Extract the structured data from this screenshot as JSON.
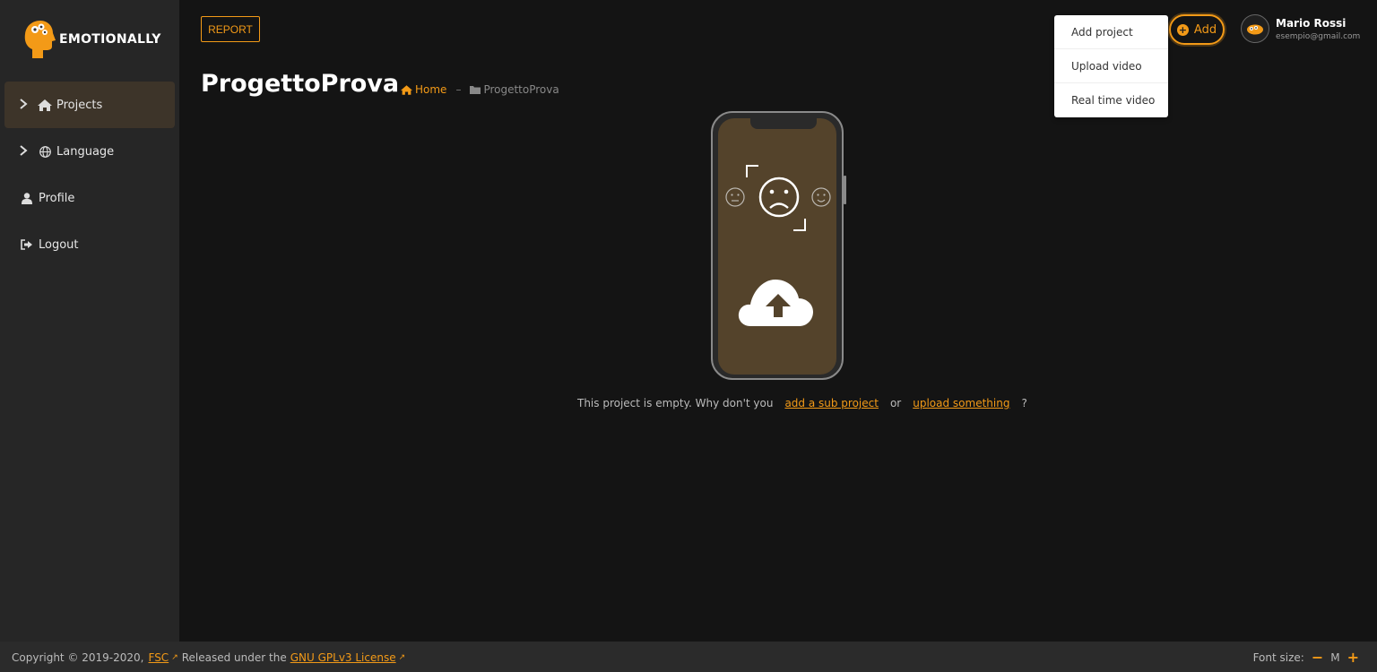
{
  "app": {
    "brand": "EMOTIONALLY"
  },
  "sidebar": {
    "items": [
      {
        "label": "Projects",
        "icon": "home-icon",
        "expandable": true,
        "active": true
      },
      {
        "label": "Language",
        "icon": "globe-icon",
        "expandable": true,
        "active": false
      },
      {
        "label": "Profile",
        "icon": "user-icon",
        "expandable": false,
        "active": false
      },
      {
        "label": "Logout",
        "icon": "logout-icon",
        "expandable": false,
        "active": false
      }
    ]
  },
  "header": {
    "report_label": "REPORT",
    "add_label": "Add",
    "add_menu": [
      "Add project",
      "Upload video",
      "Real time video"
    ],
    "user": {
      "name": "Mario Rossi",
      "email": "esempio@gmail.com"
    }
  },
  "page": {
    "title": "ProgettoProva",
    "breadcrumb": {
      "home": "Home",
      "separator": "–",
      "current": "ProgettoProva"
    }
  },
  "empty_state": {
    "text_before": "This project is empty. Why don't you",
    "link_sub_project": "add a sub project",
    "or": "or",
    "link_upload": "upload something",
    "question": "?"
  },
  "footer": {
    "copyright": "Copyright © 2019-2020,",
    "fsc_link": "FSC",
    "released": "Released under the",
    "license_link": "GNU GPLv3 License",
    "font_size_label": "Font size:",
    "font_size_value": "M",
    "minus": "−",
    "plus": "+"
  },
  "colors": {
    "accent": "#f39a17",
    "background": "#141414",
    "sidebar": "#262626",
    "phone_screen": "#54432b"
  }
}
